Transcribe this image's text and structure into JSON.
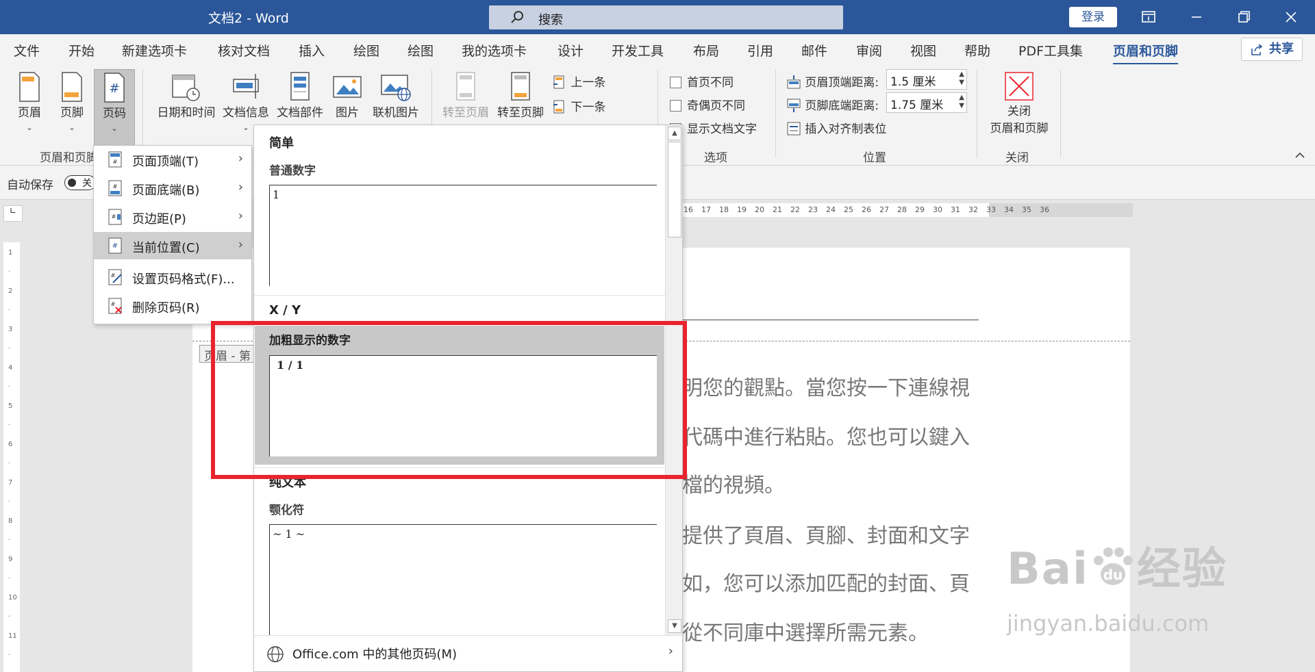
{
  "titlebar": {
    "title": "文档2  -  Word",
    "search_placeholder": "搜索",
    "login_label": "登录"
  },
  "tabs": {
    "items": [
      "文件",
      "开始",
      "新建选项卡",
      "核对文档",
      "插入",
      "绘图",
      "绘图",
      "我的选项卡",
      "设计",
      "开发工具",
      "布局",
      "引用",
      "邮件",
      "审阅",
      "视图",
      "帮助",
      "PDF工具集",
      "页眉和页脚"
    ],
    "active": "页眉和页脚",
    "share_label": "共享"
  },
  "ribbon": {
    "header_footer_group": {
      "header": "页眉",
      "footer": "页脚",
      "page_number": "页码",
      "label": "页眉和页脚"
    },
    "insert_group": {
      "date_time": "日期和时间",
      "doc_info": "文档信息",
      "doc_parts": "文档部件",
      "picture": "图片",
      "online_picture": "联机图片"
    },
    "nav_group": {
      "goto_header": "转至页眉",
      "goto_footer": "转至页脚",
      "previous": "上一条",
      "next": "下一条"
    },
    "options_group": {
      "diff_first": "首页不同",
      "diff_odd_even": "奇偶页不同",
      "show_doc_text": "显示文档文字",
      "label": "选项"
    },
    "position_group": {
      "header_top_label": "页眉顶端距离:",
      "header_top_value": "1.5 厘米",
      "footer_bottom_label": "页脚底端距离:",
      "footer_bottom_value": "1.75 厘米",
      "insert_align_tab": "插入对齐制表位",
      "label": "位置"
    },
    "close_group": {
      "close_label_1": "关闭",
      "close_label_2": "页眉和页脚",
      "label": "关闭"
    }
  },
  "qat": {
    "autosave_label": "自动保存",
    "toggle_text": "关"
  },
  "menu": {
    "items": [
      {
        "label": "页面顶端(T)",
        "submenu": true
      },
      {
        "label": "页面底端(B)",
        "submenu": true
      },
      {
        "label": "页边距(P)",
        "submenu": true
      },
      {
        "label": "当前位置(C)",
        "submenu": true
      },
      {
        "label": "设置页码格式(F)...",
        "submenu": false
      },
      {
        "label": "删除页码(R)",
        "submenu": false
      }
    ]
  },
  "gallery": {
    "section_simple": "简单",
    "plain_number_title": "普通数字",
    "plain_number_preview": "1",
    "section_xy": "X / Y",
    "bold_number_title": "加粗显示的数字",
    "bold_number_preview": "1 / 1",
    "section_plain_text": "纯文本",
    "tilde_title": "颚化符",
    "tilde_preview": "~ 1 ~",
    "footer_label": "Office.com 中的其他页码(M)"
  },
  "document": {
    "header_tag": "页眉 - 第",
    "lines": [
      "明您的觀點。當您按一下連線視",
      "代碼中進行粘貼。您也可以鍵入",
      "檔的視頻。",
      "提供了頁眉、頁腳、封面和文字",
      "如，您可以添加匹配的封面、頁",
      "從不同庫中選擇所需元素。"
    ],
    "ruler_ticks": [
      "16",
      "17",
      "18",
      "19",
      "20",
      "21",
      "22",
      "23",
      "24",
      "25",
      "26",
      "27",
      "28",
      "29",
      "30",
      "31",
      "32",
      "33",
      "34",
      "35",
      "36"
    ]
  },
  "watermark": {
    "brand": "Bai",
    "brand_suffix": "经验",
    "url": "jingyan.baidu.com"
  },
  "colors": {
    "titlebar": "#2b579a",
    "highlight_box": "#e8242e"
  }
}
